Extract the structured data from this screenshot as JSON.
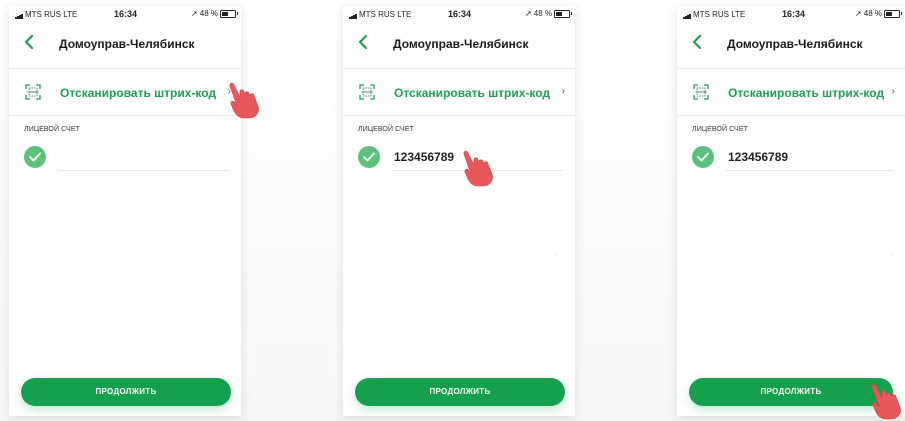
{
  "phones": [
    {
      "status": {
        "carrier": "MTS RUS",
        "network": "LTE",
        "time": "16:34",
        "battery": "48 %"
      },
      "nav": {
        "title": "Домоуправ-Челябинск"
      },
      "scan": {
        "label": "Отсканировать штрих-код"
      },
      "account": {
        "caption": "ЛИЦЕВОЙ СЧЕТ",
        "value": ""
      },
      "continue_label": "ПРОДОЛЖИТЬ"
    },
    {
      "status": {
        "carrier": "MTS RUS",
        "network": "LTE",
        "time": "16:34",
        "battery": "48 %"
      },
      "nav": {
        "title": "Домоуправ-Челябинск"
      },
      "scan": {
        "label": "Отсканировать штрих-код"
      },
      "account": {
        "caption": "ЛИЦЕВОЙ СЧЕТ",
        "value": "123456789"
      },
      "continue_label": "ПРОДОЛЖИТЬ"
    },
    {
      "status": {
        "carrier": "MTS RUS",
        "network": "LTE",
        "time": "16:34",
        "battery": "48 %"
      },
      "nav": {
        "title": "Домоуправ-Челябинск"
      },
      "scan": {
        "label": "Отсканировать штрих-код"
      },
      "account": {
        "caption": "ЛИЦЕВОЙ СЧЕТ",
        "value": "123456789"
      },
      "continue_label": "ПРОДОЛЖИТЬ"
    }
  ],
  "icons": {
    "back": "chevron-left-icon",
    "scan": "barcode-scan-icon",
    "chevron": "chevron-right-icon",
    "check": "check-icon",
    "hand": "pointing-hand-icon"
  },
  "colors": {
    "accent_green": "#14a04d",
    "check_green": "#5cc27b",
    "link_green": "#1f9d57",
    "hand_red": "#e8585a"
  }
}
